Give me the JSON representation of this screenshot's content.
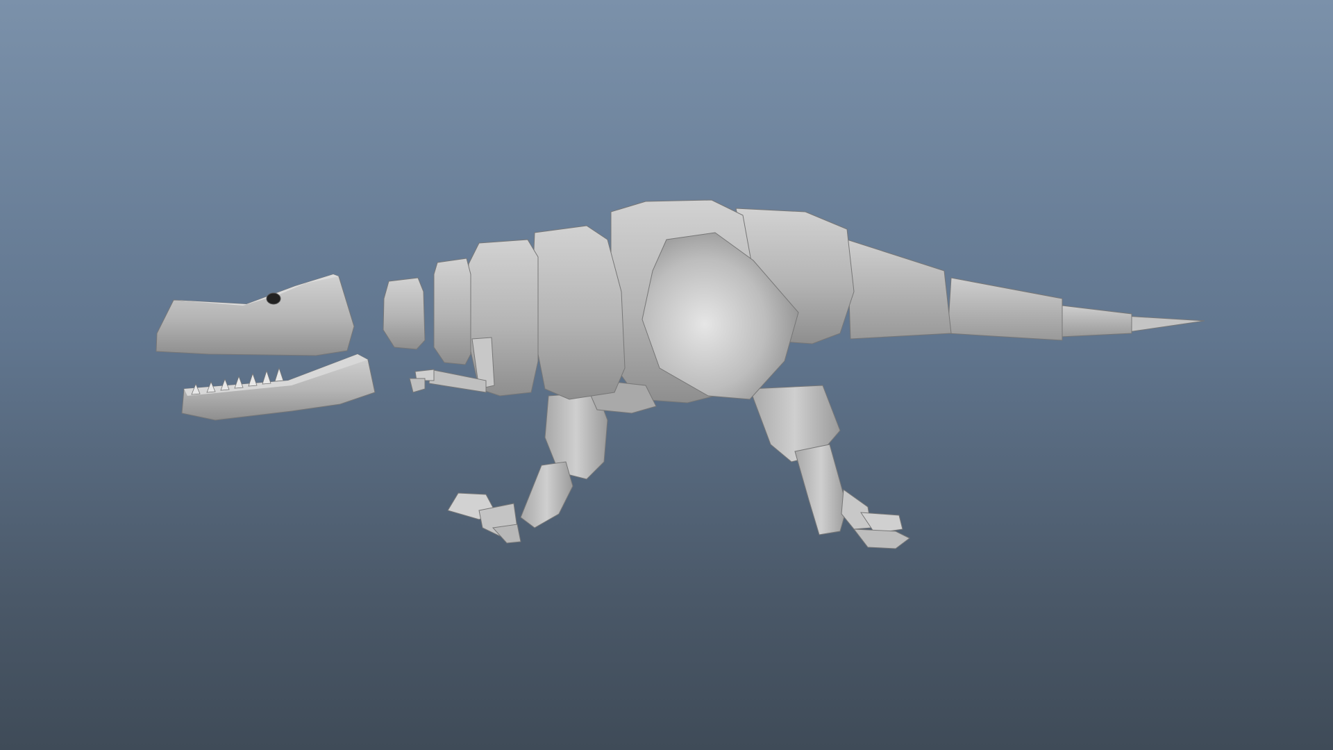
{
  "viewport": {
    "background_top": "#7b91aa",
    "background_bottom": "#3f4b58"
  },
  "model": {
    "material_color": "#bdbdbd",
    "material_light": "#e2e2e2",
    "material_shadow": "#8c8c8c",
    "edge_color": "#6f6f6f",
    "parts": [
      "head",
      "jaw",
      "teeth",
      "eye",
      "neck-segment",
      "chest-segment",
      "body-segment",
      "hip",
      "tail-segment",
      "front-leg",
      "back-leg",
      "foot",
      "arm"
    ]
  }
}
